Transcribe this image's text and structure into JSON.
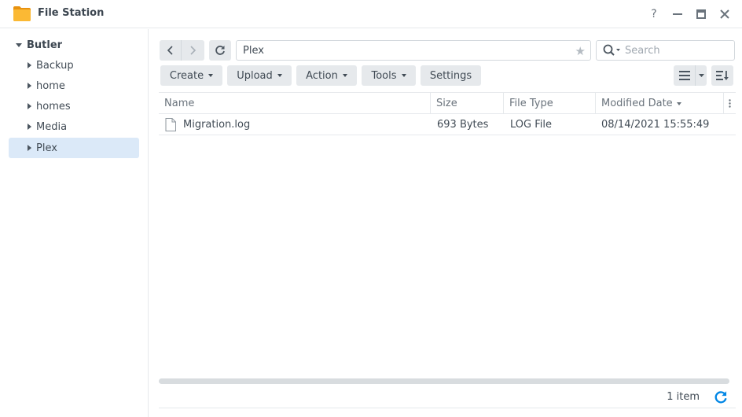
{
  "window": {
    "title": "File Station",
    "help_label": "?",
    "minimize_label": "—",
    "maximize_label": "▭",
    "close_label": "✕"
  },
  "sidebar": {
    "root": "Butler",
    "items": [
      {
        "label": "Backup"
      },
      {
        "label": "home"
      },
      {
        "label": "homes"
      },
      {
        "label": "Media"
      },
      {
        "label": "Plex",
        "selected": true
      }
    ]
  },
  "toolbar": {
    "path": "Plex",
    "search_placeholder": "Search",
    "buttons": {
      "create": "Create",
      "upload": "Upload",
      "action": "Action",
      "tools": "Tools",
      "settings": "Settings"
    }
  },
  "grid": {
    "columns": {
      "name": "Name",
      "size": "Size",
      "type": "File Type",
      "modified": "Modified Date"
    },
    "rows": [
      {
        "name": "Migration.log",
        "size": "693 Bytes",
        "type": "LOG File",
        "modified": "08/14/2021 15:55:49"
      }
    ]
  },
  "status": {
    "count": "1 item"
  },
  "colors": {
    "accent": "#0086e5",
    "selected_bg": "#dbe9f8",
    "folder": "#f5a623"
  }
}
